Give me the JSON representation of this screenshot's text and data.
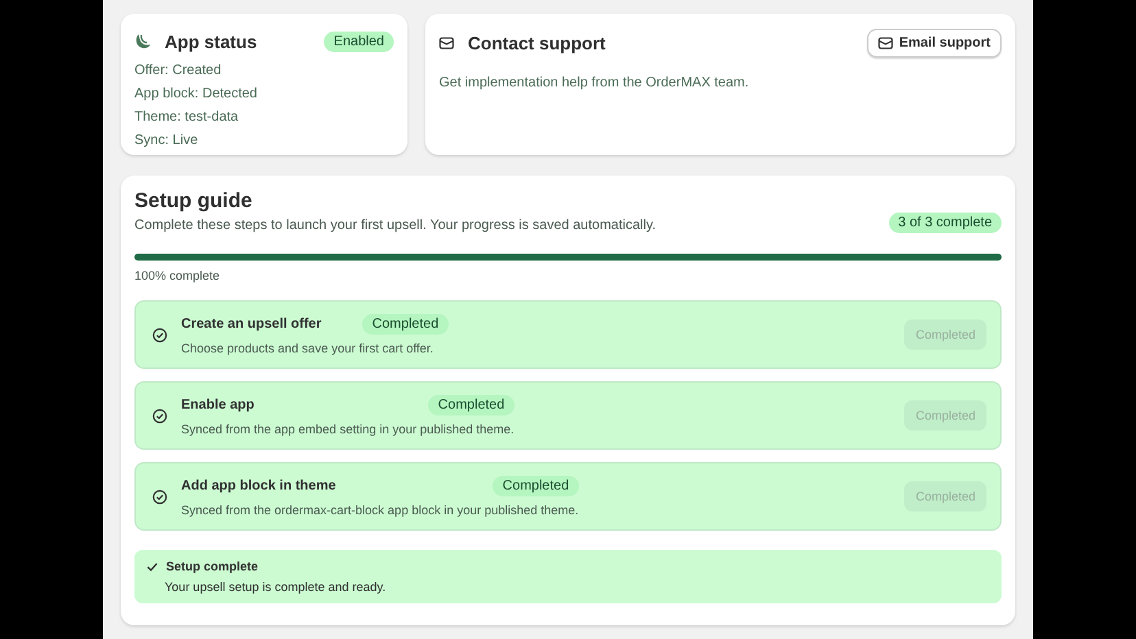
{
  "app_status": {
    "title": "App status",
    "badge": "Enabled",
    "enabled": true,
    "lines": [
      "Offer: Created",
      "App block: Detected",
      "Theme: test-data",
      "Sync: Live"
    ]
  },
  "contact_support": {
    "title": "Contact support",
    "button": "Email support",
    "description": "Get implementation help from the OrderMAX team."
  },
  "setup_guide": {
    "title": "Setup guide",
    "subtitle": "Complete these steps to launch your first upsell. Your progress is saved automatically.",
    "count_badge": "3 of 3 complete",
    "progress": {
      "level": 1,
      "label": "100% complete"
    },
    "steps": [
      {
        "title": "Create an upsell offer",
        "badge": "Completed",
        "description": "Choose products and save your first cart offer.",
        "completed": true,
        "button": "Completed",
        "disabled": true
      },
      {
        "title": "Enable app",
        "badge": "Completed",
        "description": "Synced from the app embed setting in your published theme.",
        "completed": true,
        "button": "Completed",
        "disabled": true
      },
      {
        "title": "Add app block in theme",
        "badge": "Completed",
        "description": "Synced from the ordermax-cart-block app block in your published theme.",
        "completed": true,
        "button": "Completed",
        "disabled": true
      }
    ],
    "banner": {
      "title": "Setup complete",
      "message": "Your upsell setup is complete and ready."
    }
  }
}
